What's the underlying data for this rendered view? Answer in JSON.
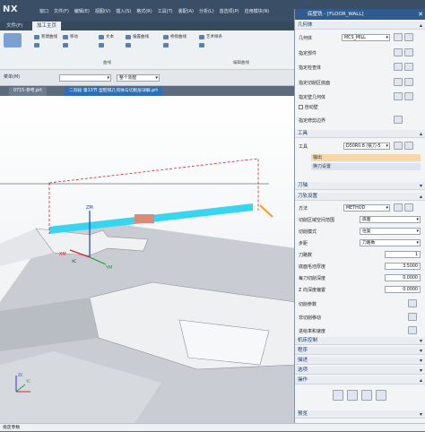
{
  "app": {
    "logo": "NX"
  },
  "menu": [
    "窗口",
    "文件(F)",
    "编辑(E)",
    "视图(V)",
    "插入(S)",
    "格式(R)",
    "工具(T)",
    "装配(A)",
    "分析(L)",
    "首选项(P)",
    "应用模块(N)",
    "窗口"
  ],
  "ribbon_tabs": [
    "文件(F)",
    "主页",
    "加工主页"
  ],
  "ribbon_items": [
    "新建曲线",
    "移动",
    "文本",
    "偏置曲线",
    "桥接曲线",
    "艺术样条"
  ],
  "ribbon_groups": [
    "曲线",
    "编辑曲线"
  ],
  "toolbar": {
    "menu_label": "菜单(M)",
    "filter": "",
    "assembly": "整个装配"
  },
  "doc_tabs": [
    "0715-参考.prt",
    "二刻段 第13节 型腔铣几何体与切削层详解.prt"
  ],
  "viewport_axes": {
    "zm": "ZM",
    "xm": "XM",
    "ym": "YM",
    "xc": "XC",
    "yc": "YC",
    "zc": "ZC"
  },
  "status": "指定参数",
  "dialog": {
    "title": "底壁铣 - [FLOOR_WALL]",
    "sections": {
      "geometry": "几何体",
      "tool": "工具",
      "axis": "刀轴",
      "path": "刀轨设置",
      "machine": "机床控制",
      "program": "程序",
      "description": "描述",
      "options": "选项",
      "actions": "操作",
      "preview": "预览"
    },
    "geometry_label": "几何体",
    "geometry_value": "MCS_MILL",
    "geometry_rows": [
      "指定部件",
      "指定检查体",
      "指定切削区底面",
      "指定壁几何体",
      "自动壁",
      "指定修剪边界"
    ],
    "tool_label": "工具",
    "tool_value": "D50R0.8 (铣刀-5",
    "tool_rows": [
      "输出",
      "换刀设置"
    ],
    "path_rows": [
      {
        "label": "方法",
        "value": "METHOD"
      },
      {
        "label": "切削区域空间范围",
        "value": "底面"
      },
      {
        "label": "切削模式",
        "value": "往复"
      },
      {
        "label": "步距",
        "value": "刀路数"
      },
      {
        "label": "刀路数",
        "value": "1"
      },
      {
        "label": "底面毛坯厚度",
        "value": "3.5000"
      },
      {
        "label": "每刀切削深度",
        "value": "0.0000"
      },
      {
        "label": "Z 向深度偏置",
        "value": "0.0000"
      }
    ],
    "param_rows": [
      "切削参数",
      "非切削移动",
      "进给率和速度"
    ],
    "colors": {
      "title_bar": "#2f5b8f",
      "accent": "#2d6fb6",
      "highlight": "#f5d7a8"
    }
  }
}
